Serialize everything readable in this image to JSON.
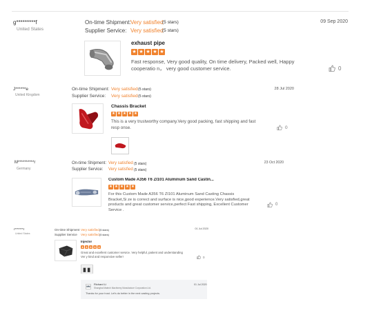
{
  "labels": {
    "shipment": "On-time Shipment:",
    "service": "Supplier Service:"
  },
  "labels_small": {
    "shipment": "On-time Shipment",
    "service": "Supplier Service"
  },
  "reviews": [
    {
      "user": "g*********f",
      "country": "United States",
      "date": "09 Sep 2020",
      "shipment_rating": "Very satisfied",
      "shipment_stars": "(5 stars)",
      "service_rating": "Very satisfied",
      "service_stars": "(5 stars)",
      "product": "exhaust pipe",
      "comment": "Fast response, Very good quality, On time delivery, Packed well, Happy cooperatio n， very good customer service.",
      "likes": "0"
    },
    {
      "user": "J******e",
      "country": "United Kingdom",
      "date": "28 Jul 2020",
      "shipment_rating": "Very satisfied",
      "shipment_stars": "(5 stars)",
      "service_rating": "Very satisfied",
      "service_stars": "(5 stars)",
      "product": "Chassis Bracket",
      "comment": "This is a very trustworthy company.Very good packing, fast shipping and fast resp onse.",
      "likes": "0"
    },
    {
      "user": "M**********r",
      "country": "Germany",
      "date": "23 Oct 2020",
      "shipment_rating": "Very satisfied",
      "shipment_stars": "(5 stars)",
      "service_rating": "Very satisfied",
      "service_stars": "(5 stars)",
      "product": "Custom Made A356 T6 ZI101 Aluminum Sand Castin...",
      "comment": "For this Custom Made A356 T6 ZI101 Aluminum Sand Casting Chassis Bracket,Si ze is correct and surface is nice,good experience.Very satisfied,great products and great customer service,perfect Fast shipping, Excellent Customer Service .",
      "likes": "0"
    },
    {
      "user": "r*******r",
      "country": "United States",
      "date": "01 Jul 2020",
      "shipment_rating": "Very satisfied",
      "shipment_stars": "(5 stars)",
      "service_rating": "Very satisfied",
      "service_stars": "(5 stars)",
      "product": "Injector",
      "comment": "Great and excellent customer service. Very helpful, patient and understanding Ver y kind and responsive seller!",
      "likes": "0",
      "reply": {
        "name": "Richard Li",
        "company": "Shanghai Matech Machinery Manufacture Corporation Ltd.",
        "date": "01 Jul 2020",
        "text": "Thanks for your trust. Let's do better in the next casting projects.",
        "badge": "MM"
      }
    }
  ],
  "colors": {
    "accent": "#f0822d"
  }
}
